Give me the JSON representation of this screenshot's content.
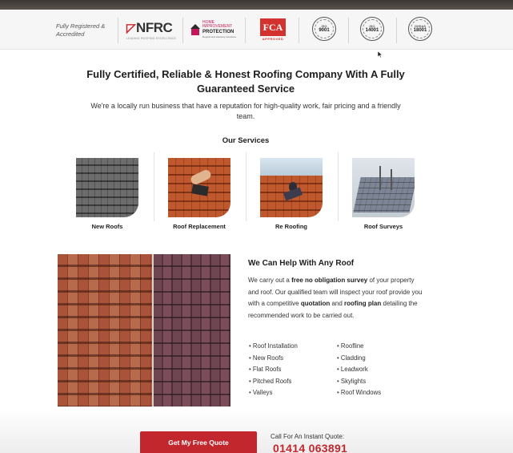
{
  "accreditation": {
    "label": "Fully Registered & Accredited",
    "nfrc": {
      "name": "NFRC",
      "tagline": "LEADING ROOFING EXCELLENCE"
    },
    "hip": {
      "line1": "HOME",
      "line2": "IMPROVEMENT",
      "line3": "PROTECTION",
      "tagline": "Deposit and warranty insurance"
    },
    "fca": {
      "name": "FCA",
      "sub": "APPROVED"
    },
    "iso_badges": [
      {
        "top": "ISO",
        "code": "9001"
      },
      {
        "top": "ISO",
        "code": "14001"
      },
      {
        "top": "OHSAS",
        "code": "18001"
      }
    ]
  },
  "hero": {
    "headline": "Fully Certified, Reliable & Honest Roofing Company With A Fully Guaranteed Service",
    "intro": "We're a locally run business that have a reputation for high-quality work, fair pricing and a friendly team."
  },
  "services": {
    "heading": "Our Services",
    "items": [
      {
        "label": "New Roofs"
      },
      {
        "label": "Roof Replacement"
      },
      {
        "label": "Re Roofing"
      },
      {
        "label": "Roof Surveys"
      }
    ]
  },
  "help": {
    "heading": "We Can Help With Any Roof",
    "p1": "We carry out a ",
    "b1": "free no obligation survey",
    "p2": " of your property and roof. Our qualified team will inspect your roof provide you with a competitive ",
    "b2": "quotation",
    "p3": " and ",
    "b3": "roofing plan",
    "p4": " detailing the recommended work to be carried out.",
    "list_left": [
      "Roof Installation",
      "New Roofs",
      "Flat Roofs",
      "Pitched Roofs",
      "Valleys"
    ],
    "list_right": [
      "Roofline",
      "Cladding",
      "Leadwork",
      "Skylights",
      "Roof Windows"
    ]
  },
  "cta": {
    "button": "Get My Free Quote",
    "call_label": "Call For An Instant Quote:",
    "phone": "01414 063891"
  }
}
